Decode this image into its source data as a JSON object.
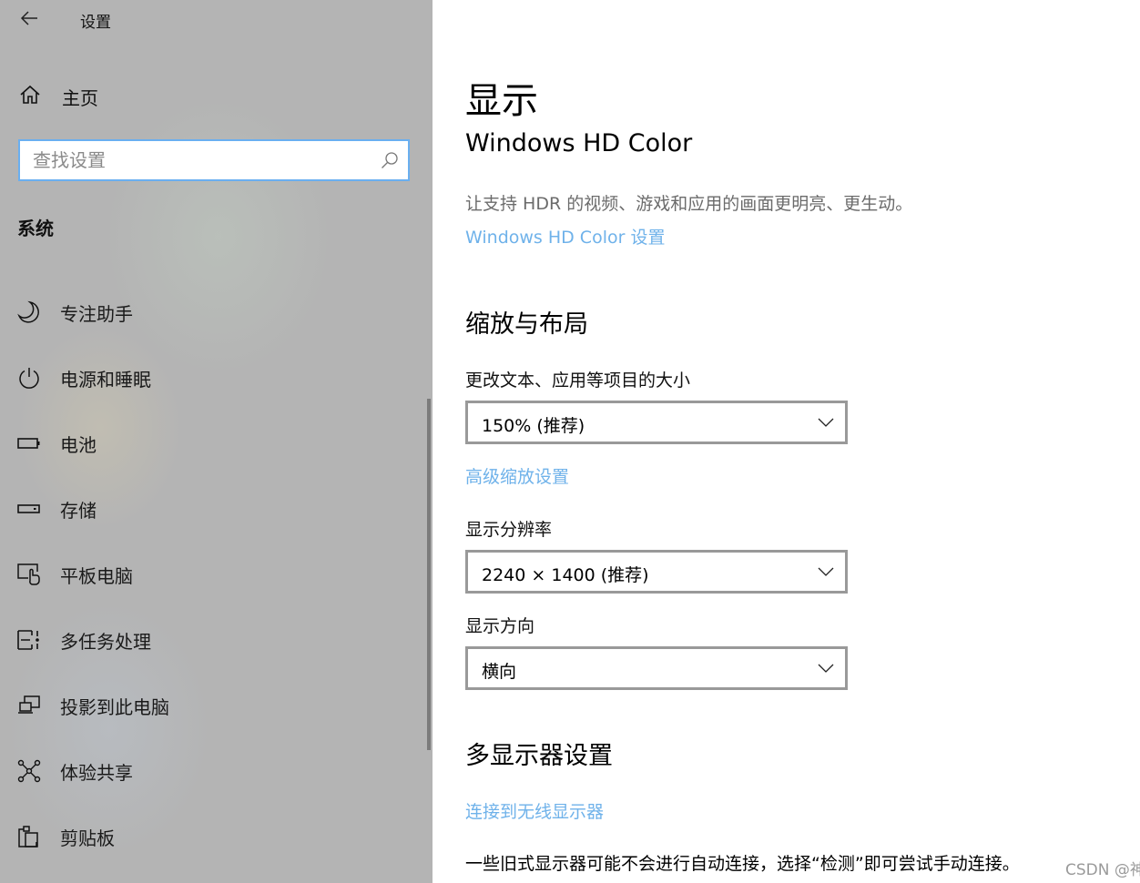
{
  "window": {
    "title": "设置",
    "back_icon": "arrow-left-icon"
  },
  "sidebar": {
    "home": {
      "label": "主页",
      "icon": "home-icon"
    },
    "search": {
      "placeholder": "查找设置",
      "value": "",
      "icon": "search-icon"
    },
    "section_label": "系统",
    "items": [
      {
        "label": "专注助手",
        "icon": "moon-icon"
      },
      {
        "label": "电源和睡眠",
        "icon": "power-icon"
      },
      {
        "label": "电池",
        "icon": "battery-icon"
      },
      {
        "label": "存储",
        "icon": "storage-icon"
      },
      {
        "label": "平板电脑",
        "icon": "tablet-icon"
      },
      {
        "label": "多任务处理",
        "icon": "multitasking-icon"
      },
      {
        "label": "投影到此电脑",
        "icon": "project-icon"
      },
      {
        "label": "体验共享",
        "icon": "share-icon"
      },
      {
        "label": "剪贴板",
        "icon": "clipboard-icon"
      }
    ]
  },
  "main": {
    "page_title": "显示",
    "hdr": {
      "heading": "Windows HD Color",
      "description": "让支持 HDR 的视频、游戏和应用的画面更明亮、更生动。",
      "link": "Windows HD Color 设置"
    },
    "scale_layout": {
      "heading": "缩放与布局",
      "scale_label": "更改文本、应用等项目的大小",
      "scale_value": "150% (推荐)",
      "advanced_link": "高级缩放设置",
      "resolution_label": "显示分辨率",
      "resolution_value": "2240 × 1400 (推荐)",
      "orientation_label": "显示方向",
      "orientation_value": "横向"
    },
    "multi_display": {
      "heading": "多显示器设置",
      "wireless_link": "连接到无线显示器",
      "note": "一些旧式显示器可能不会进行自动连接，选择“检测”即可尝试手动连接。"
    }
  },
  "watermark": "CSDN @神奇小白",
  "colors": {
    "accent_link": "#6fb2ea",
    "search_border": "#6aaff0",
    "sidebar_bg": "#b4b4b4",
    "select_border": "#999999",
    "description_text": "#6b6b6b"
  }
}
